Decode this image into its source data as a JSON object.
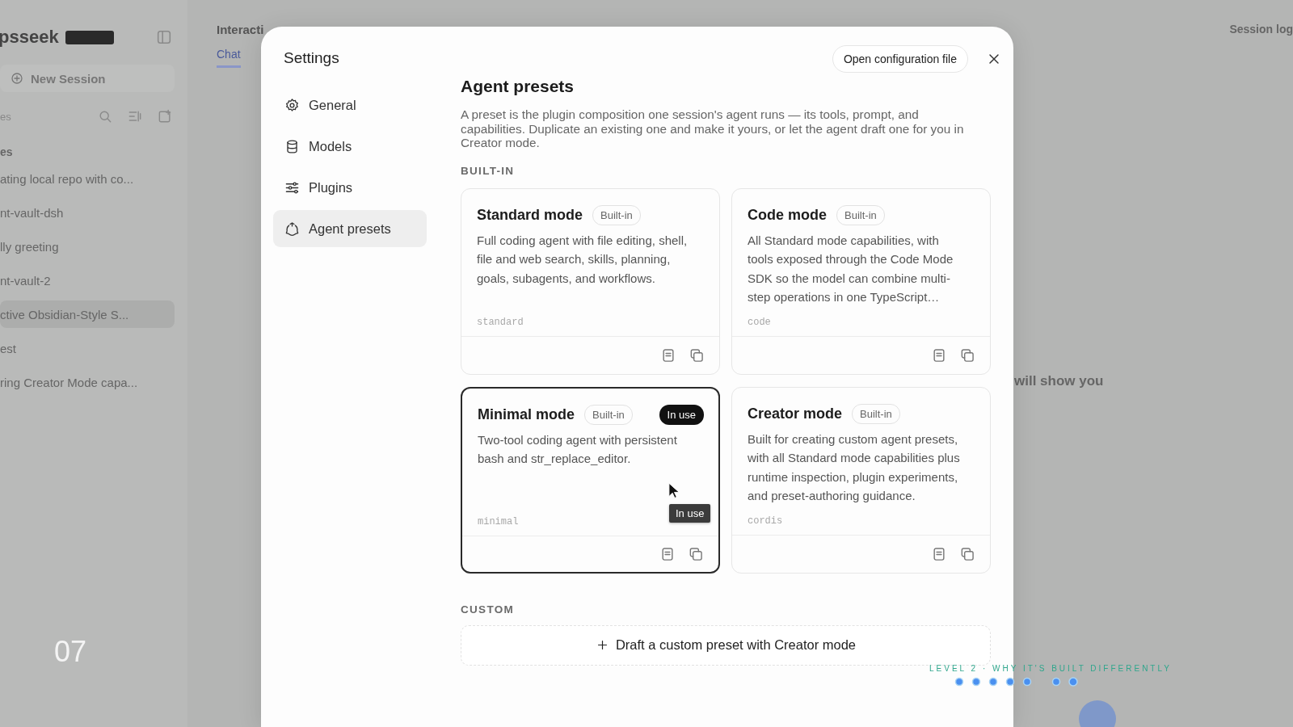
{
  "background": {
    "app_name": "psseek",
    "new_session": "New Session",
    "list_label": "es",
    "group_label": "es",
    "sessions": [
      {
        "title": "ating local repo with co...",
        "selected": false
      },
      {
        "title": "nt-vault-dsh",
        "selected": false
      },
      {
        "title": "lly greeting",
        "selected": false
      },
      {
        "title": "nt-vault-2",
        "selected": false
      },
      {
        "title": "ctive Obsidian-Style S...",
        "selected": true
      },
      {
        "title": "est",
        "selected": false
      },
      {
        "title": "ring Creator Mode capa...",
        "selected": false
      }
    ],
    "header_title": "Interacti",
    "tabs": [
      {
        "label": "Chat",
        "selected": true
      }
    ],
    "session_log": "Session log",
    "chat_text": "will show you"
  },
  "settings": {
    "title": "Settings",
    "open_config": "Open configuration file",
    "nav": [
      {
        "label": "General",
        "selected": false
      },
      {
        "label": "Models",
        "selected": false
      },
      {
        "label": "Plugins",
        "selected": false
      },
      {
        "label": "Agent presets",
        "selected": true
      }
    ],
    "heading": "Agent presets",
    "description": "A preset is the plugin composition one session's agent runs — its tools, prompt, and capabilities. Duplicate an existing one and make it yours, or let the agent draft one for you in Creator mode.",
    "builtin_label": "BUILT-IN",
    "presets": [
      {
        "name": "Standard mode",
        "tag": "Built-in",
        "in_use": false,
        "selected": false,
        "description": "Full coding agent with file editing, shell, file and web search, skills, planning, goals, subagents, and workflows.",
        "id": "standard"
      },
      {
        "name": "Code mode",
        "tag": "Built-in",
        "in_use": false,
        "selected": false,
        "description": "All Standard mode capabilities, with tools exposed through the Code Mode SDK so the model can combine multi-step operations in one TypeScript…",
        "id": "code"
      },
      {
        "name": "Minimal mode",
        "tag": "Built-in",
        "in_use": true,
        "in_use_label": "In use",
        "selected": true,
        "description": "Two-tool coding agent with persistent bash and str_replace_editor.",
        "id": "minimal",
        "tooltip": "In use"
      },
      {
        "name": "Creator mode",
        "tag": "Built-in",
        "in_use": false,
        "selected": false,
        "description": "Built for creating custom agent presets, with all Standard mode capabilities plus runtime inspection, plugin experiments, and preset-authoring guidance.",
        "id": "cordis"
      }
    ],
    "custom_label": "CUSTOM",
    "draft_button": "Draft a custom preset with Creator mode"
  },
  "slide": {
    "number": "07",
    "caption": "LEVEL 2 · WHY IT'S BUILT DIFFERENTLY"
  }
}
